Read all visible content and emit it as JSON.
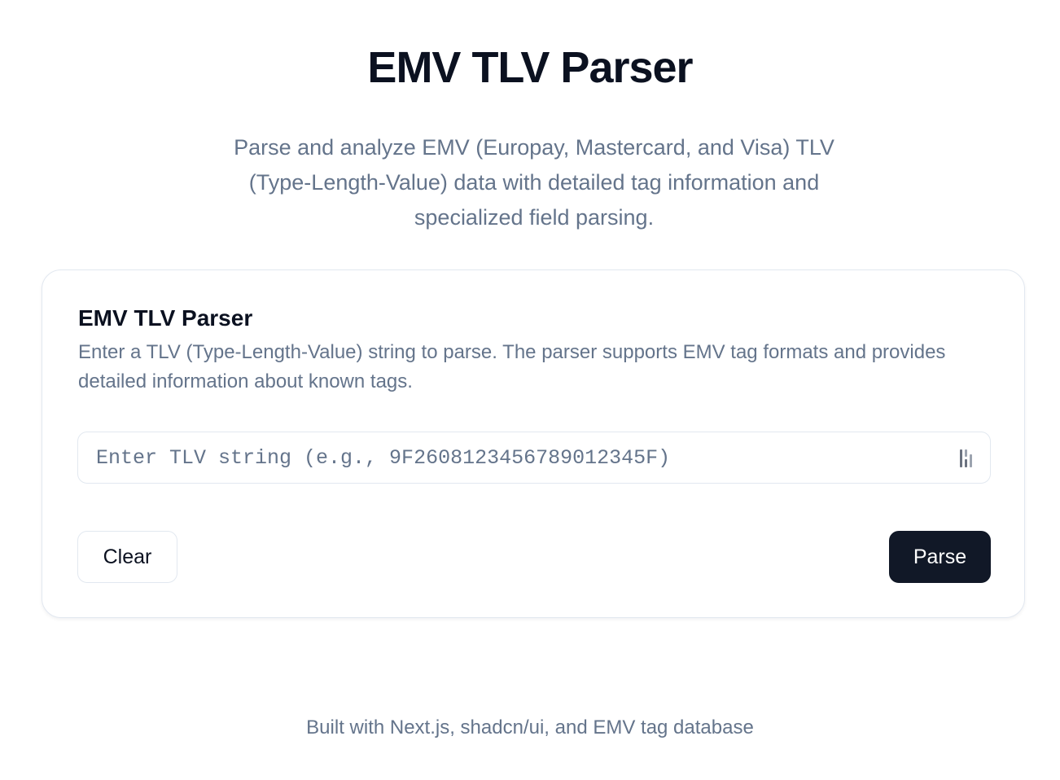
{
  "header": {
    "title": "EMV TLV Parser",
    "subtitle": "Parse and analyze EMV (Europay, Mastercard, and Visa) TLV (Type-Length-Value) data with detailed tag information and specialized field parsing."
  },
  "card": {
    "title": "EMV TLV Parser",
    "description": "Enter a TLV (Type-Length-Value) string to parse. The parser supports EMV tag formats and provides detailed information about known tags.",
    "input": {
      "value": "",
      "placeholder": "Enter TLV string (e.g., 9F2608123456789012345F)",
      "icon": "password-manager-icon"
    },
    "buttons": {
      "clear_label": "Clear",
      "parse_label": "Parse"
    }
  },
  "footer": {
    "text": "Built with Next.js, shadcn/ui, and EMV tag database"
  },
  "colors": {
    "title": "#0b1120",
    "muted_text": "#64748b",
    "border": "#e2e8f0",
    "primary_button": "#111827",
    "primary_button_text": "#ffffff",
    "background": "#ffffff"
  }
}
